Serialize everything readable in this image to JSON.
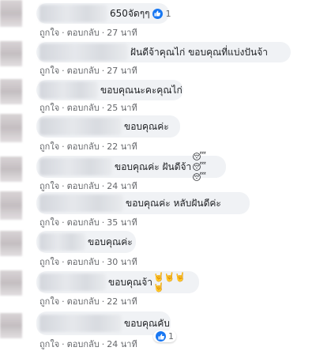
{
  "actions": {
    "like": "ถูกใจ",
    "reply": "ตอบกลับ",
    "separator": "·"
  },
  "comments": [
    {
      "text": "650จัดๆๆ",
      "time": "27 นาที",
      "likes": "1"
    },
    {
      "text": "ฝันดีจ้าคุณไก่ ขอบคุณที่แบ่งปันจ้า",
      "time": "27 นาที"
    },
    {
      "text": "ขอบคุณนะคะคุณไก่",
      "time": "25 นาที"
    },
    {
      "text": "ขอบคุณค่ะ",
      "time": "22 นาที"
    },
    {
      "text": "ขอบคุณค่ะ ฝันดีจ้า",
      "emoji": "😴😴😴",
      "time": "24 นาที"
    },
    {
      "text": "ขอบคุณค่ะ หลับฝันดีค่ะ",
      "time": "35 นาที"
    },
    {
      "text": "ขอบคุณค่ะ",
      "time": "30 นาที"
    },
    {
      "text": "ขอบคุณจ้า",
      "emoji": "🤘🤘🤘🤘",
      "time": "22 นาที"
    },
    {
      "text": "ขอบคุณคับ",
      "time": "24 นาที",
      "likes": "1"
    }
  ],
  "colors": {
    "accent": "#1877f2",
    "bubble": "#f0f2f5",
    "meta": "#65676b"
  },
  "icons": {
    "like": "thumbs-up-icon"
  }
}
